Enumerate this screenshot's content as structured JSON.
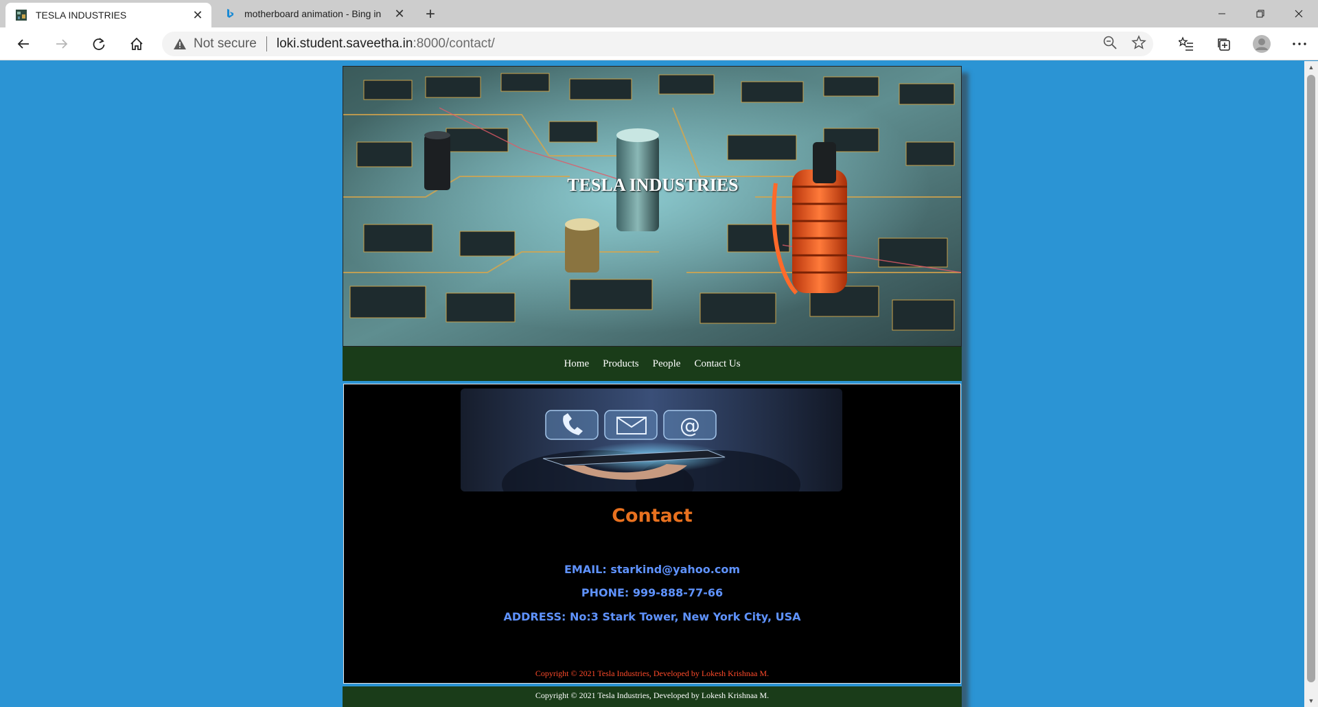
{
  "browser": {
    "tabs": [
      {
        "title": "TESLA INDUSTRIES",
        "active": true
      },
      {
        "title": "motherboard animation - Bing in",
        "active": false
      }
    ],
    "address": {
      "security_label": "Not secure",
      "url_host": "loki.student.saveetha.in",
      "url_rest": ":8000/contact/"
    }
  },
  "site": {
    "title": "TESLA INDUSTRIES",
    "nav": [
      "Home",
      "Products",
      "People",
      "Contact Us"
    ],
    "contact_heading": "Contact",
    "email": "EMAIL: starkind@yahoo.com",
    "phone": "PHONE: 999-888-77-66",
    "address": "ADDRESS: No:3 Stark Tower, New York City, USA",
    "copyright_inner": "Copyright © 2021 Tesla Industries, Developed by Lokesh Krishnaa M.",
    "copyright_footer": "Copyright © 2021 Tesla Industries, Developed by Lokesh Krishnaa M."
  },
  "colors": {
    "page_bg": "#2b94d4",
    "nav_bg": "#1a3c19",
    "heading": "#e8711f",
    "info_text": "#5f93ff",
    "copyright_inner": "#ff4a2a"
  }
}
